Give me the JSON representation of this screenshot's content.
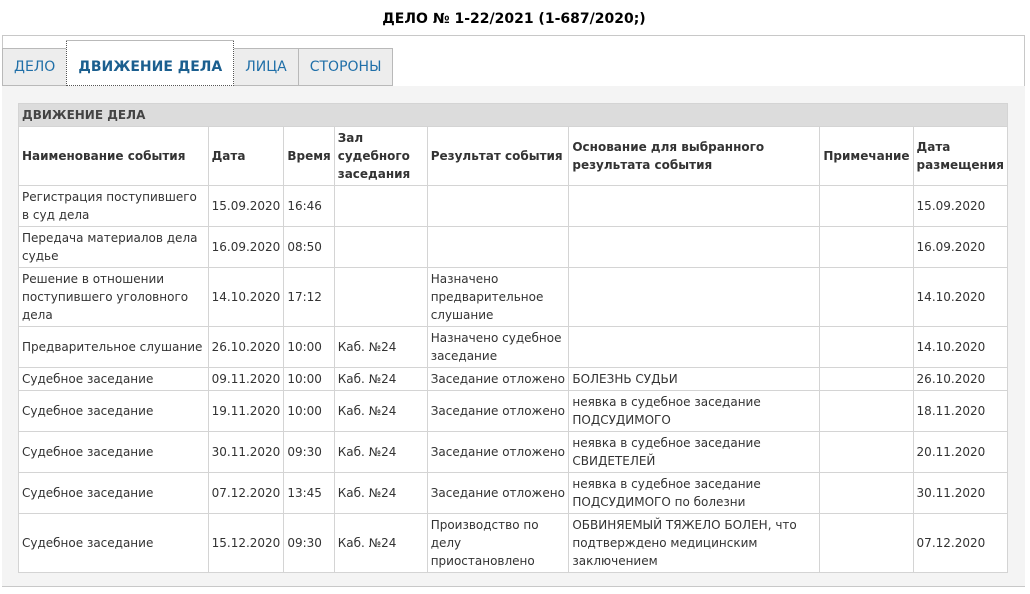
{
  "case": {
    "title": "ДЕЛО № 1-22/2021 (1-687/2020;)"
  },
  "tabs": [
    {
      "label": "ДЕЛО"
    },
    {
      "label": "ДВИЖЕНИЕ ДЕЛА"
    },
    {
      "label": "ЛИЦА"
    },
    {
      "label": "СТОРОНЫ"
    }
  ],
  "table": {
    "section_title": "ДВИЖЕНИЕ ДЕЛА",
    "headers": [
      "Наименование события",
      "Дата",
      "Время",
      "Зал судебного заседания",
      "Результат события",
      "Основание для выбранного результата события",
      "Примечание",
      "Дата размещения"
    ],
    "rows": [
      [
        "Регистрация поступившего в суд дела",
        "15.09.2020",
        "16:46",
        "",
        "",
        "",
        "",
        "15.09.2020"
      ],
      [
        "Передача материалов дела судье",
        "16.09.2020",
        "08:50",
        "",
        "",
        "",
        "",
        "16.09.2020"
      ],
      [
        "Решение в отношении поступившего уголовного дела",
        "14.10.2020",
        "17:12",
        "",
        "Назначено предварительное слушание",
        "",
        "",
        "14.10.2020"
      ],
      [
        "Предварительное слушание",
        "26.10.2020",
        "10:00",
        "Каб. №24",
        "Назначено судебное заседание",
        "",
        "",
        "14.10.2020"
      ],
      [
        "Судебное заседание",
        "09.11.2020",
        "10:00",
        "Каб. №24",
        "Заседание отложено",
        "БОЛЕЗНЬ СУДЬИ",
        "",
        "26.10.2020"
      ],
      [
        "Судебное заседание",
        "19.11.2020",
        "10:00",
        "Каб. №24",
        "Заседание отложено",
        "неявка в судебное заседание ПОДСУДИМОГО",
        "",
        "18.11.2020"
      ],
      [
        "Судебное заседание",
        "30.11.2020",
        "09:30",
        "Каб. №24",
        "Заседание отложено",
        "неявка в судебное заседание СВИДЕТЕЛЕЙ",
        "",
        "20.11.2020"
      ],
      [
        "Судебное заседание",
        "07.12.2020",
        "13:45",
        "Каб. №24",
        "Заседание отложено",
        "неявка в судебное заседание ПОДСУДИМОГО по болезни",
        "",
        "30.11.2020"
      ],
      [
        "Судебное заседание",
        "15.12.2020",
        "09:30",
        "Каб. №24",
        "Производство по делу приостановлено",
        "ОБВИНЯЕМЫЙ ТЯЖЕЛО БОЛЕН, что подтверждено медицинским заключением",
        "",
        "07.12.2020"
      ]
    ]
  }
}
